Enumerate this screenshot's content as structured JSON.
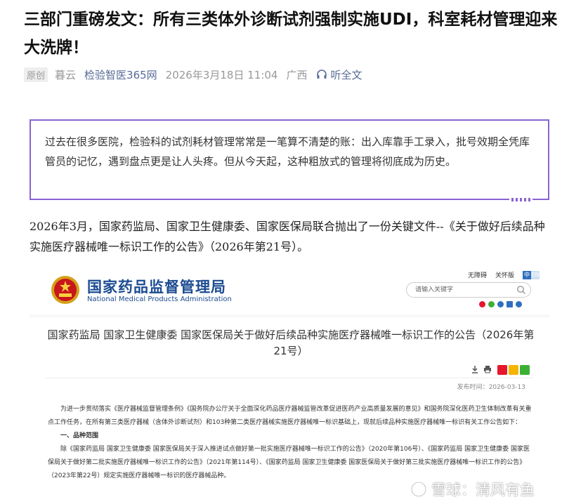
{
  "article": {
    "title": "三部门重磅发文：所有三类体外诊断试剂强制实施UDI，科室耗材管理迎来大洗牌！",
    "badge": "原创",
    "author": "暮云",
    "source": "检验智医365网",
    "date": "2026年3月18日 11:04",
    "region": "广西",
    "listen": "听全文",
    "quote": "过去在很多医院，检验科的试剂耗材管理常常是一笔算不清楚的账：出入库靠手工录入，批号效期全凭库管员的记忆，遇到盘点更是让人头疼。但从今天起，这种粗放式的管理将彻底成为历史。",
    "paragraph": "2026年3月，国家药监局、国家卫生健康委、国家医保局联合抛出了一份关键文件--《关于做好后续品种实施医疗器械唯一标识工作的公告》（2026年第21号）。"
  },
  "screenshot": {
    "org_cn": "国家药品监督管理局",
    "org_en": "National Medical Products Administration",
    "util_links": [
      "无障碍",
      "关怀版"
    ],
    "lang": [
      "中",
      "EN"
    ],
    "search_placeholder": "请输入关键字",
    "doc_title": "国家药监局 国家卫生健康委 国家医保局关于做好后续品种实施医疗器械唯一标识工作的公告（2026年第21号）",
    "pub_label": "发布时间：",
    "pub_date": "2026-03-13",
    "body_p1": "为进一步贯彻落实《医疗器械监督管理条例》《国务院办公厅关于全面深化药品医疗器械监管改革促进医药产业高质量发展的意见》和国务院深化医药卫生体制改革有关重点工作任务，在所有第三类医疗器械（含体外诊断试剂）和103种第二类医疗器械实施医疗器械唯一标识基础上，现就后续品种实施医疗器械唯一标识有关工作公告如下：",
    "section1": "一、品种范围",
    "body_p2": "除《国家药监局 国家卫生健康委 国家医保局关于深入推进试点做好第一批实施医疗器械唯一标识工作的公告》（2020年第106号）、《国家药监局 国家卫生健康委 国家医保局关于做好第二批实施医疗器械唯一标识工作的公告》（2021年第114号）、《国家药监局 国家卫生健康委 国家医保局关于做好第三批实施医疗器械唯一标识工作的公告》（2023年第22号）规定实施医疗器械唯一标识的医疗器械品种。"
  },
  "watermark": "雪球：清风有鱼",
  "colors": {
    "accent": "#576b95",
    "quote_border": "#8a63d2",
    "org_blue": "#1b4b91"
  }
}
